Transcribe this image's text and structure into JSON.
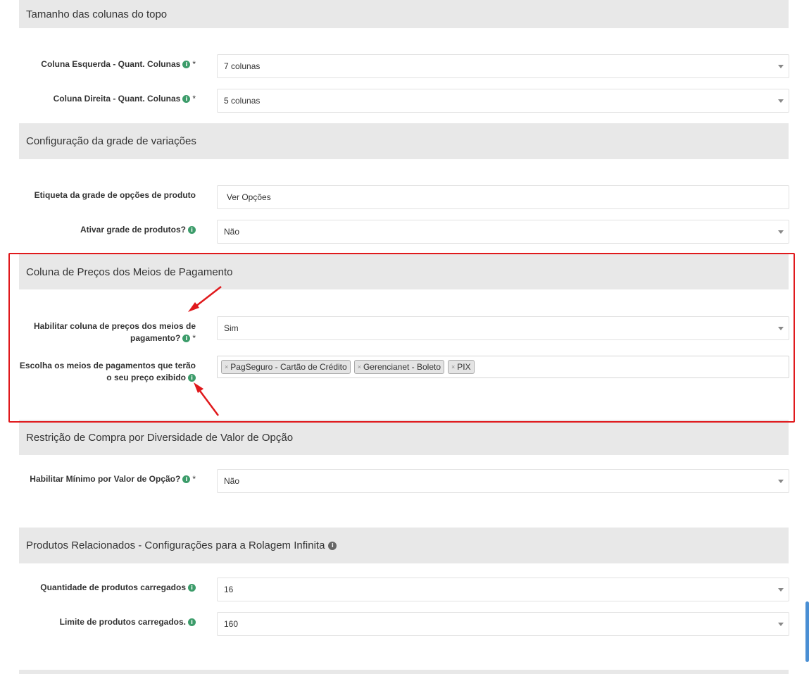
{
  "sections": {
    "top_columns": "Tamanho das colunas do topo",
    "variation_grid": "Configuração da grade de variações",
    "payment_prices": "Coluna de Preços dos Meios de Pagamento",
    "purchase_restriction": "Restrição de Compra por Diversidade de Valor de Opção",
    "related_products": "Produtos Relacionados - Configurações para a Rolagem Infinita"
  },
  "fields": {
    "left_column": {
      "label": "Coluna Esquerda - Quant. Colunas",
      "value": "7 colunas"
    },
    "right_column": {
      "label": "Coluna Direita - Quant. Colunas",
      "value": "5 colunas"
    },
    "grid_label": {
      "label": "Etiqueta da grade de opções de produto",
      "value": "Ver Opções"
    },
    "enable_grid": {
      "label": "Ativar grade de produtos?",
      "value": "Não"
    },
    "enable_payment_column": {
      "label_line1": "Habilitar coluna de preços dos meios de",
      "label_line2": "pagamento?",
      "value": "Sim"
    },
    "payment_methods": {
      "label_line1": "Escolha os meios de pagamentos que terão",
      "label_line2": "o seu preço exibido",
      "tags": [
        "PagSeguro - Cartão de Crédito",
        "Gerencianet - Boleto",
        "PIX"
      ]
    },
    "min_option_value": {
      "label": "Habilitar Mínimo por Valor de Opção?",
      "value": "Não"
    },
    "products_loaded": {
      "label": "Quantidade de produtos carregados",
      "value": "16"
    },
    "products_limit": {
      "label": "Limite de produtos carregados.",
      "value": "160"
    }
  },
  "symbols": {
    "required": "*",
    "info": "i",
    "remove": "×"
  },
  "colors": {
    "highlight": "#e0191c",
    "info_icon": "#3c9c6a",
    "header_bg": "#e8e8e8"
  }
}
